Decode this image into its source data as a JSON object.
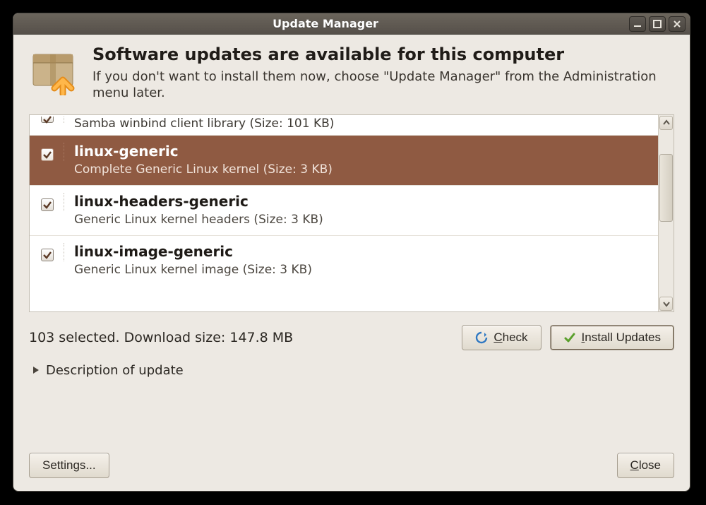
{
  "window": {
    "title": "Update Manager"
  },
  "header": {
    "heading": "Software updates are available for this computer",
    "subtext": "If you don't want to install them now, choose \"Update Manager\" from the Administration menu later."
  },
  "updates": [
    {
      "name": "",
      "desc": "Samba winbind client library (Size: 101 KB)",
      "checked": true,
      "partial": true,
      "selected": false
    },
    {
      "name": "linux-generic",
      "desc": "Complete Generic Linux kernel (Size: 3 KB)",
      "checked": true,
      "partial": false,
      "selected": true
    },
    {
      "name": "linux-headers-generic",
      "desc": "Generic Linux kernel headers (Size: 3 KB)",
      "checked": true,
      "partial": false,
      "selected": false
    },
    {
      "name": "linux-image-generic",
      "desc": "Generic Linux kernel image (Size: 3 KB)",
      "checked": true,
      "partial": false,
      "selected": false
    }
  ],
  "status": {
    "text": "103 selected. Download size: 147.8 MB"
  },
  "buttons": {
    "check_prefix": "C",
    "check_rest": "heck",
    "install_prefix": "I",
    "install_rest": "nstall Updates",
    "settings": "Settings...",
    "close_prefix": "C",
    "close_rest": "lose"
  },
  "expander": {
    "label": "Description of update"
  }
}
